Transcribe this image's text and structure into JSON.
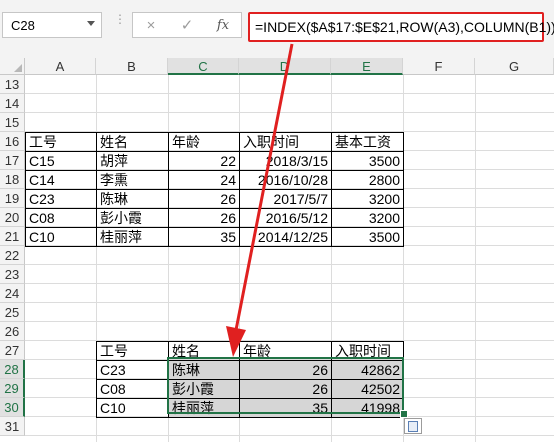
{
  "formula_bar": {
    "name_box": "C28",
    "cancel_icon": "×",
    "enter_icon": "✓",
    "fx_label": "fx",
    "formula": "=INDEX($A$17:$E$21,ROW(A3),COLUMN(B1))"
  },
  "columns": [
    "A",
    "B",
    "C",
    "D",
    "E",
    "F",
    "G"
  ],
  "rows": [
    "13",
    "14",
    "15",
    "16",
    "17",
    "18",
    "19",
    "20",
    "21",
    "22",
    "23",
    "24",
    "25",
    "26",
    "27",
    "28",
    "29",
    "30",
    "31"
  ],
  "source_table": {
    "headers": [
      "工号",
      "姓名",
      "年龄",
      "入职时间",
      "基本工资"
    ],
    "rows": [
      [
        "C15",
        "胡萍",
        "22",
        "2018/3/15",
        "3500"
      ],
      [
        "C14",
        "李熏",
        "24",
        "2016/10/28",
        "2800"
      ],
      [
        "C23",
        "陈琳",
        "26",
        "2017/5/7",
        "3200"
      ],
      [
        "C08",
        "彭小霞",
        "26",
        "2016/5/12",
        "3200"
      ],
      [
        "C10",
        "桂丽萍",
        "35",
        "2014/12/25",
        "3500"
      ]
    ]
  },
  "result_table": {
    "headers": [
      "工号",
      "姓名",
      "年龄",
      "入职时间"
    ],
    "rows": [
      [
        "C23",
        "陈琳",
        "26",
        "42862"
      ],
      [
        "C08",
        "彭小霞",
        "26",
        "42502"
      ],
      [
        "C10",
        "桂丽萍",
        "35",
        "41998"
      ]
    ]
  },
  "colors": {
    "accent": "#217346",
    "callout": "#e02020",
    "selection_fill": "#d6d6d6"
  }
}
